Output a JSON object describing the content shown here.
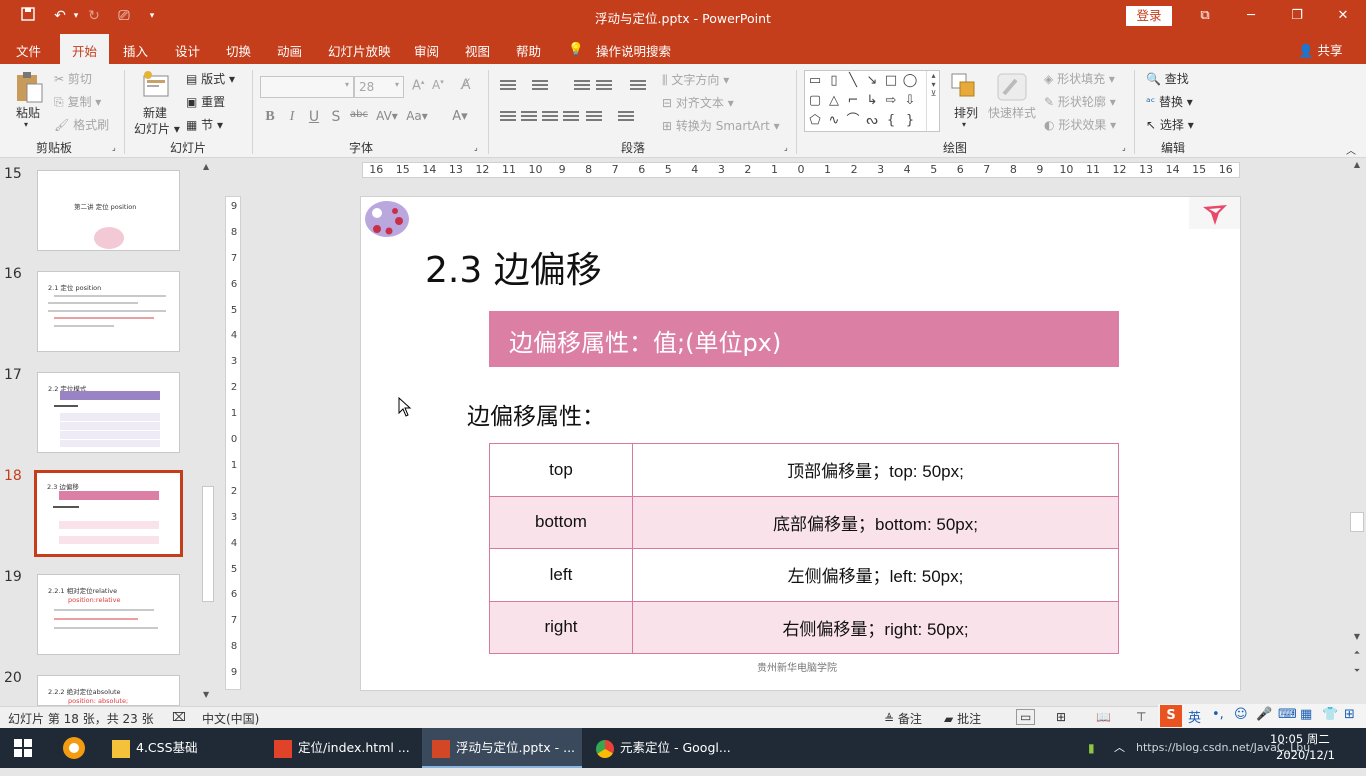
{
  "titlebar": {
    "doc_title": "浮动与定位.pptx  -  PowerPoint",
    "login": "登录",
    "save_icon": "save-icon",
    "undo_icon": "undo-icon"
  },
  "tabs": [
    "文件",
    "开始",
    "插入",
    "设计",
    "切换",
    "动画",
    "幻灯片放映",
    "审阅",
    "视图",
    "帮助",
    "操作说明搜索"
  ],
  "share": "共享",
  "ribbon": {
    "clipboard": {
      "paste": "粘贴",
      "cut": "剪切",
      "copy": "复制",
      "format_painter": "格式刷",
      "label": "剪贴板"
    },
    "slides": {
      "new_slide_1": "新建",
      "new_slide_2": "幻灯片",
      "layout": "版式",
      "reset": "重置",
      "section": "节",
      "label": "幻灯片"
    },
    "font": {
      "size": "28",
      "label": "字体",
      "bold": "B",
      "italic": "I",
      "underline": "U",
      "shadow": "S",
      "strike": "abc"
    },
    "paragraph": {
      "text_direction": "文字方向",
      "align_text": "对齐文本",
      "smartart": "转换为 SmartArt",
      "label": "段落"
    },
    "drawing": {
      "arrange": "排列",
      "quick_styles": "快速样式",
      "shape_fill": "形状填充",
      "shape_outline": "形状轮廓",
      "shape_effects": "形状效果",
      "label": "绘图"
    },
    "editing": {
      "find": "查找",
      "replace": "替换",
      "select": "选择",
      "label": "编辑"
    }
  },
  "thumbnails": [
    {
      "num": "15",
      "title": "第二讲  定位 position"
    },
    {
      "num": "16",
      "title": "2.1 定位 position"
    },
    {
      "num": "17",
      "title": "2.2 定位模式"
    },
    {
      "num": "18",
      "title": "2.3 边偏移"
    },
    {
      "num": "19",
      "title": "2.2.1 相对定位relative",
      "sub": "position:relative"
    },
    {
      "num": "20",
      "title": "2.2.2 绝对定位absolute",
      "sub": "position: absolute;"
    }
  ],
  "ruler": {
    "h_ticks": [
      "16",
      "15",
      "14",
      "13",
      "12",
      "11",
      "10",
      "9",
      "8",
      "7",
      "6",
      "5",
      "4",
      "3",
      "2",
      "1",
      "0",
      "1",
      "2",
      "3",
      "4",
      "5",
      "6",
      "7",
      "8",
      "9",
      "10",
      "11",
      "12",
      "13",
      "14",
      "15",
      "16"
    ],
    "v_ticks": [
      "9",
      "8",
      "7",
      "6",
      "5",
      "4",
      "3",
      "2",
      "1",
      "0",
      "1",
      "2",
      "3",
      "4",
      "5",
      "6",
      "7",
      "8",
      "9"
    ]
  },
  "slide": {
    "heading": "2.3 边偏移",
    "banner": "边偏移属性：值;(单位px)",
    "subheading": "边偏移属性：",
    "rows": [
      {
        "name": "top",
        "desc": "顶部偏移量；top: 50px;"
      },
      {
        "name": "bottom",
        "desc": "底部偏移量；bottom: 50px;"
      },
      {
        "name": "left",
        "desc": "左侧偏移量；left: 50px;"
      },
      {
        "name": "right",
        "desc": "右侧偏移量；right: 50px;"
      }
    ],
    "footer": "贵州新华电脑学院"
  },
  "status": {
    "slide_info": "幻灯片 第 18 张，共 23 张",
    "language": "中文(中国)",
    "notes": "备注",
    "comments": "批注"
  },
  "taskbar": {
    "items": [
      "4.CSS基础",
      "定位/index.html ...",
      "浮动与定位.pptx - ...",
      "元素定位 - Googl..."
    ],
    "time": "10:05 周二",
    "date": "2020/12/1",
    "ime": "英",
    "watermark": "https://blog.csdn.net/JavaC_Lbu"
  },
  "colors": {
    "accent": "#c43e1c",
    "banner": "#db80a4",
    "row_alt": "#f9e2ea"
  }
}
